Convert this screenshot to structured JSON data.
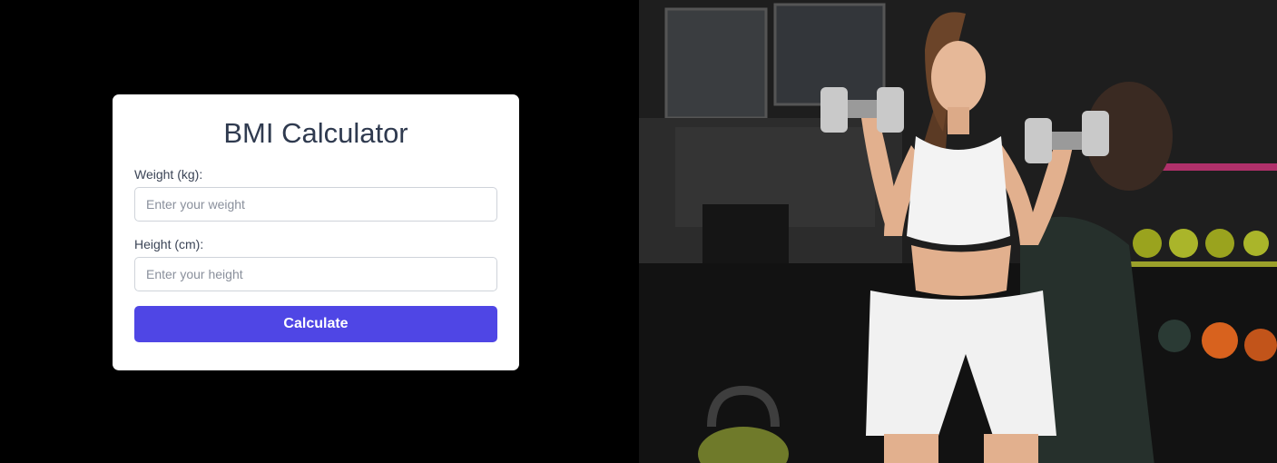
{
  "calculator": {
    "title": "BMI Calculator",
    "weight_label": "Weight (kg):",
    "weight_placeholder": "Enter your weight",
    "weight_value": "",
    "height_label": "Height (cm):",
    "height_placeholder": "Enter your height",
    "height_value": "",
    "button_label": "Calculate"
  },
  "hero_image": {
    "subject": "fitness-woman-with-dumbbells"
  },
  "colors": {
    "accent": "#4f46e5",
    "title_text": "#2f3a4f",
    "page_background": "#000000",
    "card_background": "#ffffff"
  }
}
